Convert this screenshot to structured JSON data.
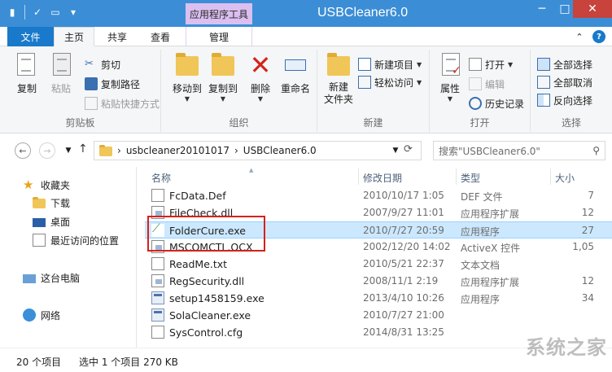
{
  "window": {
    "title": "USBCleaner6.0",
    "context_tab": "应用程序工具",
    "minimize": "─",
    "maximize": "□",
    "close": "✕"
  },
  "tabs": {
    "file": "文件",
    "home": "主页",
    "share": "共享",
    "view": "查看",
    "manage": "管理"
  },
  "ribbon": {
    "clipboard": {
      "label": "剪贴板",
      "copy": "复制",
      "paste": "粘贴",
      "cut": "剪切",
      "copy_path": "复制路径",
      "paste_shortcut": "粘贴快捷方式"
    },
    "organize": {
      "label": "组织",
      "move_to": "移动到",
      "copy_to": "复制到",
      "delete": "删除",
      "rename": "重命名"
    },
    "new": {
      "label": "新建",
      "new_folder": "新建\n文件夹",
      "new_item": "新建项目",
      "easy_access": "轻松访问"
    },
    "open": {
      "label": "打开",
      "properties": "属性",
      "open": "打开",
      "edit": "编辑",
      "history": "历史记录"
    },
    "select": {
      "label": "选择",
      "select_all": "全部选择",
      "select_none": "全部取消",
      "invert": "反向选择"
    }
  },
  "navigation": {
    "path": [
      "usbcleaner20101017",
      "USBCleaner6.0"
    ],
    "path_sep": "›",
    "search_placeholder": "搜索\"USBCleaner6.0\""
  },
  "nav_pane": {
    "favorites": "收藏夹",
    "downloads": "下载",
    "desktop": "桌面",
    "recent": "最近访问的位置",
    "this_pc": "这台电脑",
    "network": "网络"
  },
  "columns": {
    "name": "名称",
    "date": "修改日期",
    "type": "类型",
    "size": "大小"
  },
  "files": [
    {
      "name": "FcData.Def",
      "date": "2010/10/17 1:05",
      "type": "DEF 文件",
      "size": "7",
      "icon": "doc"
    },
    {
      "name": "FileCheck.dll",
      "date": "2007/9/27 11:01",
      "type": "应用程序扩展",
      "size": "12",
      "icon": "dll"
    },
    {
      "name": "FolderCure.exe",
      "date": "2010/7/27 20:59",
      "type": "应用程序",
      "size": "27",
      "icon": "foldercure",
      "selected": true
    },
    {
      "name": "MSCOMCTL.OCX",
      "date": "2002/12/20 14:02",
      "type": "ActiveX 控件",
      "size": "1,05",
      "icon": "dll"
    },
    {
      "name": "ReadMe.txt",
      "date": "2010/5/21 22:37",
      "type": "文本文档",
      "size": "",
      "icon": "doc"
    },
    {
      "name": "RegSecurity.dll",
      "date": "2008/11/1 2:19",
      "type": "应用程序扩展",
      "size": "12",
      "icon": "dll"
    },
    {
      "name": "setup1458159.exe",
      "date": "2013/4/10 10:26",
      "type": "应用程序",
      "size": "34",
      "icon": "exe"
    },
    {
      "name": "SolaCleaner.exe",
      "date": "2010/7/27 21:00",
      "type": "",
      "size": "",
      "icon": "exe"
    },
    {
      "name": "SysControl.cfg",
      "date": "2014/8/31 13:25",
      "type": "",
      "size": "",
      "icon": "doc"
    }
  ],
  "status": {
    "count": "20 个项目",
    "selection": "选中 1 个项目 270 KB"
  },
  "watermark": "系统之家"
}
